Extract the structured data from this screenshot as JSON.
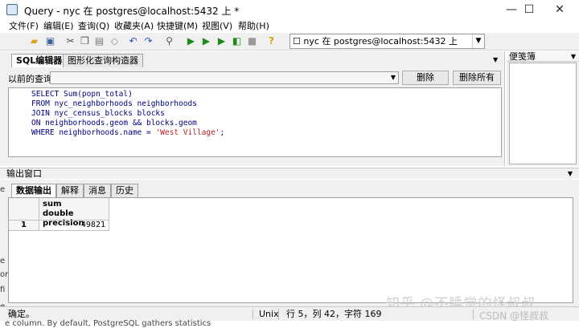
{
  "window": {
    "title": "Query - nyc 在  postgres@localhost:5432 上 *",
    "minimize": "—",
    "maximize": "☐",
    "close": "✕"
  },
  "menu": [
    "文件(F)",
    "编辑(E)",
    "查询(Q)",
    "收藏夹(A)",
    "快捷键(M)",
    "视图(V)",
    "帮助(H)"
  ],
  "toolbar": {
    "connection": "☐ nyc 在  postgres@localhost:5432 上",
    "icons": [
      "open-folder-icon",
      "save-icon",
      "cut-icon",
      "copy-icon",
      "paste-icon",
      "clear-icon",
      "undo-icon",
      "redo-icon",
      "find-icon",
      "execute-icon",
      "execute-pgscript-icon",
      "execute-to-file-icon",
      "explain-icon",
      "stop-icon",
      "help-icon"
    ]
  },
  "editor": {
    "tabs": [
      "SQL编辑器",
      "图形化查询构造器"
    ],
    "prev_label": "以前的查询",
    "delete_label": "删除",
    "delete_all_label": "删除所有",
    "sql_lines": [
      "SELECT Sum(popn_total)",
      "FROM nyc_neighborhoods neighborhoods",
      "JOIN nyc_census_blocks blocks",
      "ON neighborhoods.geom && blocks.geom",
      "WHERE neighborhoods.name = "
    ],
    "sql_string": "'West Village'",
    "sql_end": ";"
  },
  "notepad": {
    "title": "便笺簿"
  },
  "output": {
    "title": "输出窗口",
    "tabs": [
      "数据输出",
      "解释",
      "消息",
      "历史"
    ],
    "column_name": "sum",
    "column_type": "double precision",
    "row_number": "1",
    "cell_value": "49821"
  },
  "status": {
    "message": "确定。",
    "encoding": "Unix",
    "position": "行 5，列 42，字符 169"
  },
  "overlay": {
    "watermark": "知乎 @不睡觉的怪叔叔",
    "csdn": "CSDN @怪叔叔",
    "behind_text": "e column. By default, PostgreSQL gathers statistics",
    "left_fragments": [
      "e",
      "e",
      "or",
      "fi",
      "e"
    ]
  }
}
